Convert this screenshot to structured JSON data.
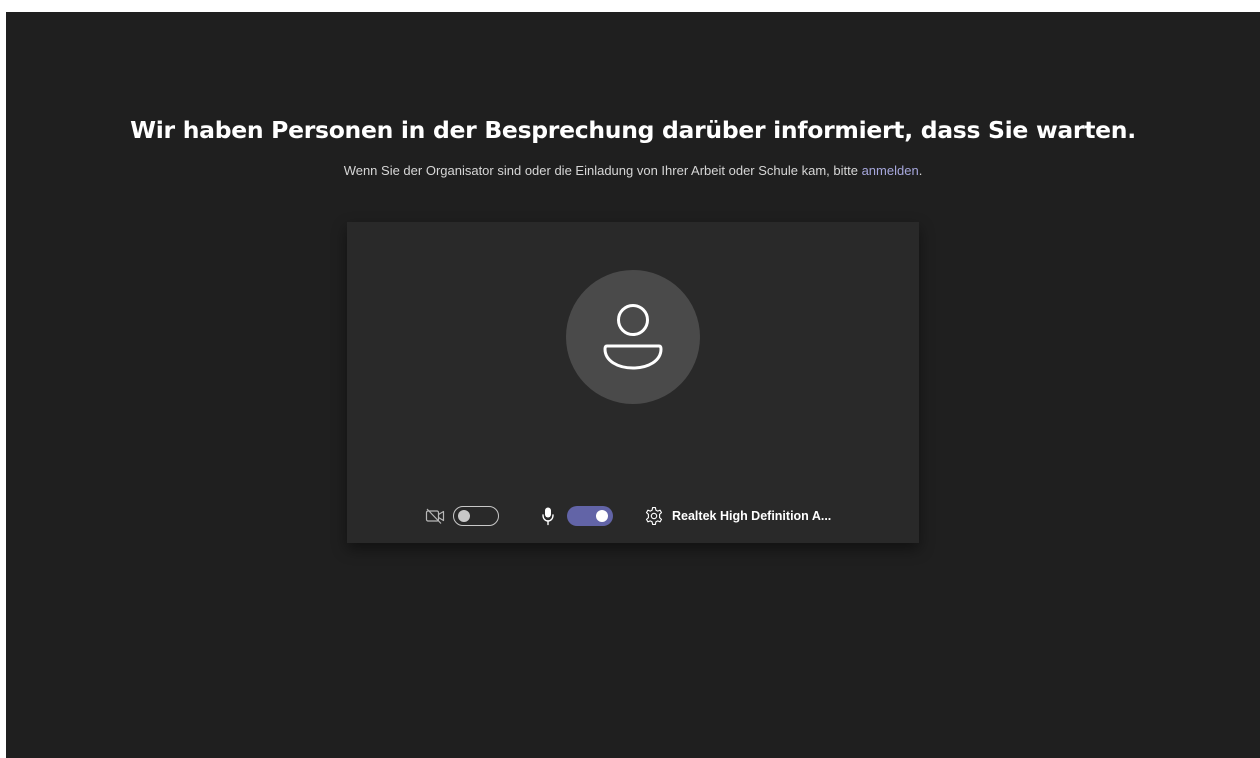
{
  "lobby": {
    "headline": "Wir haben Personen in der Besprechung darüber informiert, dass Sie warten.",
    "subline_text": "Wenn Sie der Organisator sind oder die Einladung von Ihrer Arbeit oder Schule kam, bitte ",
    "signin_link": "anmelden",
    "subline_end": "."
  },
  "preview": {
    "avatar_icon": "person-icon",
    "camera": {
      "icon": "camera-off-icon",
      "enabled": false
    },
    "microphone": {
      "icon": "microphone-icon",
      "enabled": true
    },
    "device_settings": {
      "icon": "gear-icon",
      "label": "Realtek High Definition A..."
    }
  },
  "colors": {
    "background": "#1f1f1f",
    "card": "#292929",
    "avatar": "#4a4a4a",
    "accent": "#6264a7",
    "link": "#a6a7dc"
  }
}
